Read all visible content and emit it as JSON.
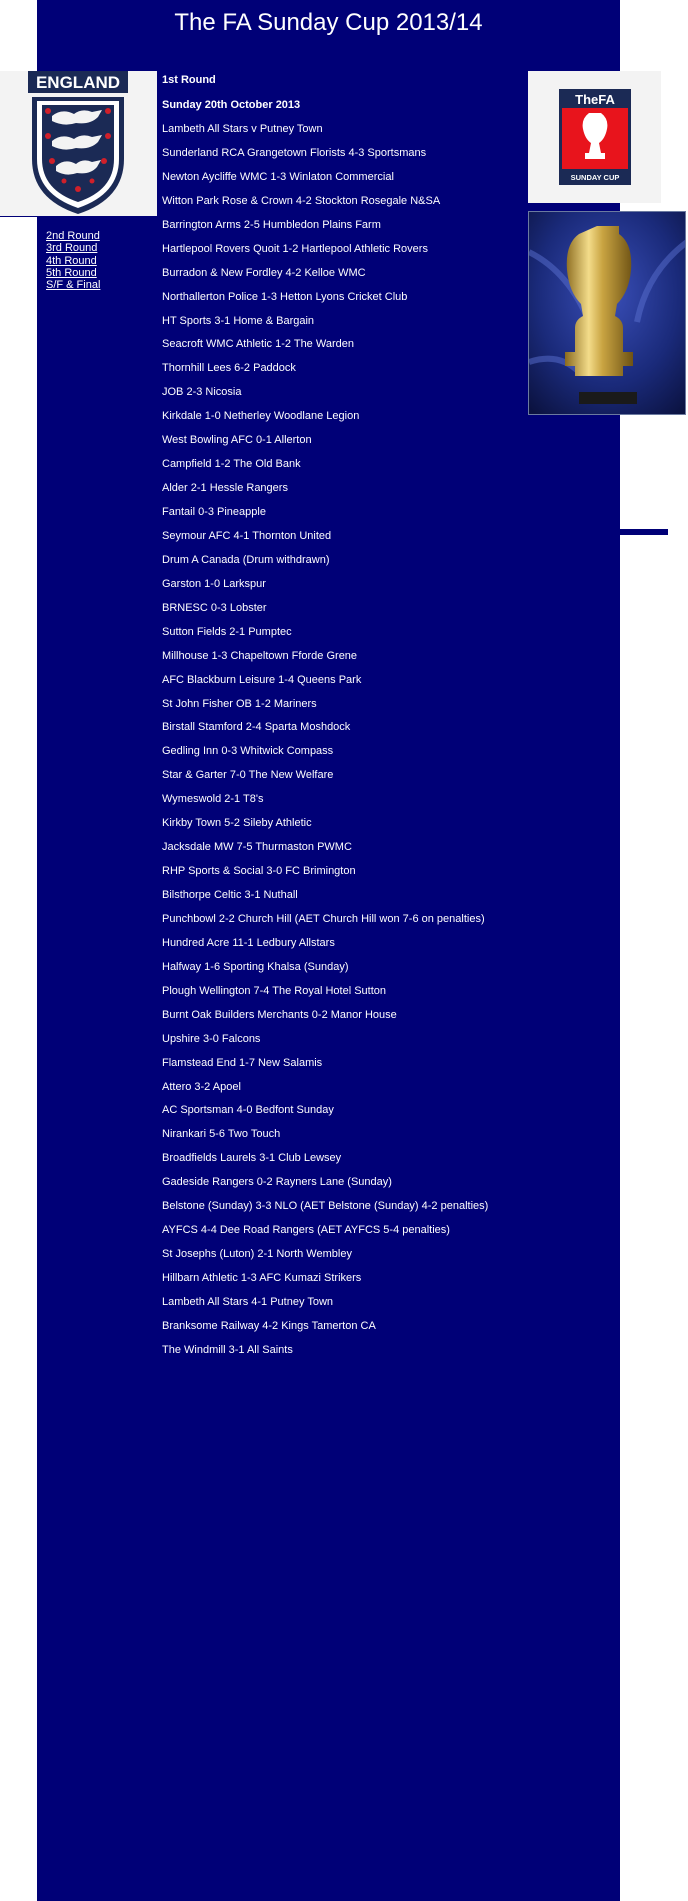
{
  "page": {
    "title": "The FA Sunday Cup 2013/14",
    "colors": {
      "panel": "#000077",
      "text": "#ffffff",
      "box": "#f3f3f3"
    }
  },
  "crest": {
    "word": "ENGLAND"
  },
  "fa_logo": {
    "wordmark": "TheFA",
    "caption": "SUNDAY CUP"
  },
  "nav": {
    "rounds": [
      "2nd Round",
      "3rd Round",
      "4th Round",
      "5th Round",
      "S/F & Final"
    ]
  },
  "round": {
    "heading": "1st Round",
    "date": "Sunday 20th October 2013"
  },
  "results": [
    "Lambeth All Stars v Putney Town",
    "Sunderland RCA Grangetown Florists 4-3 Sportsmans",
    "Newton Aycliffe WMC 1-3 Winlaton Commercial",
    "Witton Park Rose & Crown 4-2 Stockton Rosegale N&SA",
    "Barrington Arms 2-5 Humbledon Plains Farm",
    "Hartlepool Rovers Quoit 1-2 Hartlepool Athletic Rovers",
    "Burradon & New Fordley 4-2 Kelloe WMC",
    "Northallerton Police 1-3 Hetton Lyons Cricket Club",
    "HT Sports 3-1 Home & Bargain",
    "Seacroft WMC Athletic 1-2 The Warden",
    "Thornhill Lees 6-2 Paddock",
    "JOB 2-3 Nicosia",
    "Kirkdale 1-0 Netherley Woodlane Legion",
    "West Bowling AFC 0-1 Allerton",
    "Campfield 1-2 The Old Bank",
    "Alder 2-1 Hessle Rangers",
    "Fantail 0-3 Pineapple",
    "Seymour AFC 4-1 Thornton United",
    "Drum A Canada (Drum withdrawn)",
    "Garston 1-0 Larkspur",
    "BRNESC 0-3 Lobster",
    "Sutton Fields 2-1 Pumptec",
    "Millhouse 1-3 Chapeltown Fforde Grene",
    "AFC Blackburn Leisure 1-4 Queens Park",
    "St John Fisher OB 1-2 Mariners",
    "Birstall Stamford 2-4 Sparta Moshdock",
    "Gedling Inn 0-3 Whitwick Compass",
    "Star & Garter 7-0 The New Welfare",
    "Wymeswold 2-1 T8's",
    "Kirkby Town 5-2 Sileby Athletic",
    "Jacksdale MW 7-5 Thurmaston PWMC",
    "RHP Sports & Social 3-0 FC Brimington",
    "Bilsthorpe Celtic 3-1 Nuthall",
    "Punchbowl 2-2 Church Hill (AET Church Hill won 7-6 on penalties)",
    "Hundred Acre 11-1 Ledbury Allstars",
    "Halfway 1-6 Sporting Khalsa (Sunday)",
    "Plough Wellington 7-4 The Royal Hotel Sutton",
    "Burnt Oak Builders Merchants 0-2 Manor House",
    "Upshire 3-0 Falcons",
    "Flamstead End 1-7 New Salamis",
    "Attero 3-2 Apoel",
    "AC Sportsman 4-0 Bedfont Sunday",
    "Nirankari 5-6 Two Touch",
    "Broadfields Laurels 3-1 Club Lewsey",
    "Gadeside Rangers 0-2 Rayners Lane (Sunday)",
    "Belstone (Sunday) 3-3 NLO (AET Belstone (Sunday) 4-2 penalties)",
    "AYFCS 4-4 Dee Road Rangers (AET AYFCS 5-4 penalties)",
    "St Josephs (Luton) 2-1 North Wembley",
    "Hillbarn Athletic 1-3 AFC Kumazi Strikers",
    "Lambeth All Stars 4-1 Putney Town",
    "Branksome Railway 4-2 Kings Tamerton CA",
    "The Windmill 3-1 All Saints"
  ]
}
